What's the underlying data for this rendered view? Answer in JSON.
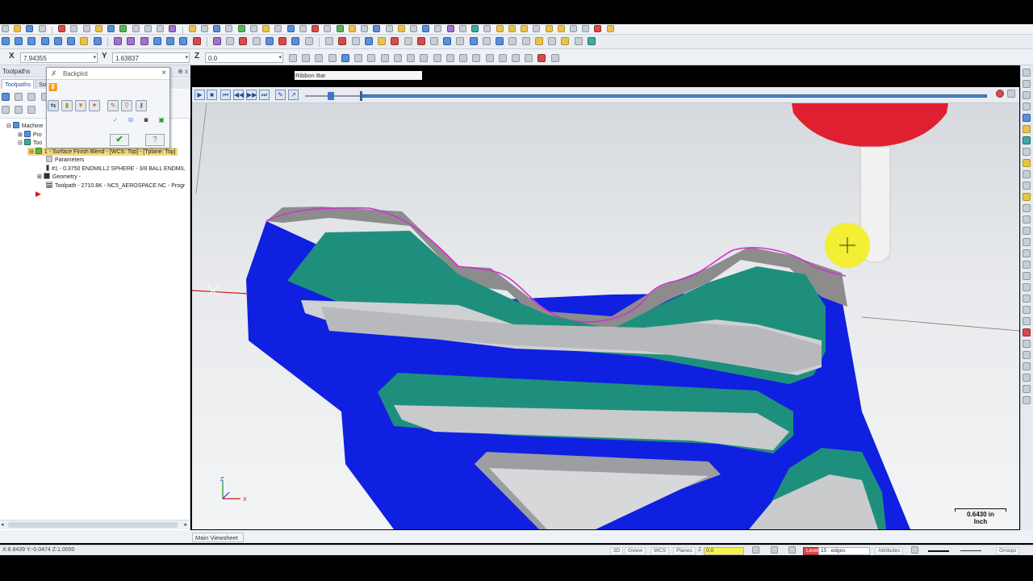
{
  "coordinates": {
    "x_label": "X",
    "x_value": "7.94355",
    "y_label": "Y",
    "y_value": "1.63837",
    "z_label": "Z",
    "z_value": "0.0"
  },
  "panel": {
    "title": "Toolpaths",
    "pins": "⊕ x",
    "tabs": [
      "Toolpaths",
      "So"
    ]
  },
  "tree": {
    "machine": "Machine",
    "properties": "Pro",
    "toolpath_group": "Too",
    "operation": "1 - Surface Finish Blend - [WCS: Top] - [Tplane: Top]",
    "parameters": "Parameters",
    "tool": "#1 - 0.3750 ENDMILL2 SPHERE - 3/8 BALL ENDMIL",
    "geometry": "Geometry -",
    "toolpath": "Toolpath - 2710.8K - NC5_AEROSPACE.NC - Progr"
  },
  "backplot": {
    "title": "Backplot",
    "ok_label": "✔",
    "help_label": "?"
  },
  "ribbon_bar_label": "Ribbon Bar",
  "viewsheet_tab": "Main Viewsheet",
  "scale": {
    "value": "0.6430 in",
    "unit": "Inch"
  },
  "triad": {
    "z": "Z",
    "x": "X"
  },
  "status": {
    "coords": "X:8.8439   Y:-0.0474   Z:1.0000",
    "3d": "3D",
    "gview": "Gview",
    "wcs": "WCS",
    "planes": "Planes",
    "z_label": "Z",
    "z_value": "0.0",
    "level_label": "Level",
    "level_value": "15 : edges",
    "attributes": "Attributes",
    "groups": "Groups"
  },
  "colors": {
    "part_blue": "#1020e0",
    "wall_teal": "#1f8f7d",
    "floor_gray": "#c9cacc",
    "tool_red": "#e02030",
    "cursor_yellow": "#f2ef2a",
    "toolpath_magenta": "#d22fd2"
  }
}
